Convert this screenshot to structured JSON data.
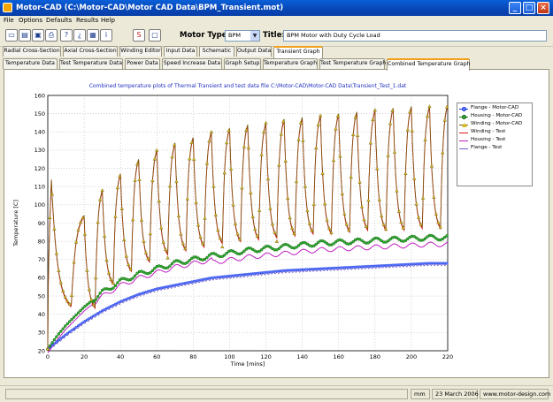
{
  "window": {
    "title": "Motor-CAD (C:\\Motor-CAD\\Motor CAD Data\\BPM_Transient.mot)",
    "minimize_glyph": "_",
    "maximize_glyph": "□",
    "close_glyph": "×"
  },
  "menu": [
    "File",
    "Options",
    "Defaults",
    "Results",
    "Help"
  ],
  "toolbar": {
    "icons": [
      "new-file-icon",
      "open-file-icon",
      "save-file-icon",
      "print-icon",
      "help-icon",
      "context-help-icon",
      "calculator-icon",
      "info-icon",
      "scaling-icon",
      "clipboard-icon"
    ],
    "motor_type_label": "Motor Type:",
    "motor_type_value": "BPM",
    "title_label": "Title:",
    "title_value": "BPM Motor with Duty Cycle Load"
  },
  "main_tabs": [
    "Radial Cross-Section",
    "Axial Cross-Section",
    "Winding Editor",
    "Input Data",
    "Schematic",
    "Output Data",
    "Transient Graph"
  ],
  "main_tab_active": "Transient Graph",
  "sub_tabs": [
    "Temperature Data",
    "Test Temperature Data",
    "Power Data",
    "Speed Increase Data",
    "Graph Setup",
    "Temperature Graph",
    "Test Temperature Graph",
    "Combined Temperature Graph"
  ],
  "sub_tab_active": "Combined Temperature Graph",
  "status": {
    "units": "mm",
    "date": "23 March 2006",
    "website": "www.motor-design.com"
  },
  "chart_data": {
    "type": "line",
    "title": "Combined temperature plots of Thermal Transient and test data file C:\\Motor-CAD\\Motor-CAD Data\\Transient_Test_1.dat",
    "xlabel": "Time [mins]",
    "ylabel": "Temperature [C]",
    "xlim": [
      0,
      220
    ],
    "ylim": [
      20,
      160
    ],
    "xticks": [
      0,
      20,
      40,
      60,
      80,
      100,
      120,
      140,
      160,
      180,
      200,
      220
    ],
    "yticks": [
      20,
      30,
      40,
      50,
      60,
      70,
      80,
      90,
      100,
      110,
      120,
      130,
      140,
      150,
      160
    ],
    "grid": true,
    "legend_position": "top-right",
    "colors": {
      "flange_cad": "#1a2fd8",
      "housing_cad": "#1a7a1a",
      "winding_cad": "#7a5a10",
      "winding_test": "#e01818",
      "housing_test": "#c020c0",
      "flange_test": "#7060d0"
    },
    "series": [
      {
        "name": "Flange - Motor-CAD",
        "key": "flange_cad",
        "marker": "circle-blue",
        "x": [
          0,
          5,
          10,
          20,
          30,
          40,
          50,
          60,
          70,
          80,
          90,
          100,
          110,
          120,
          130,
          140,
          150,
          160,
          170,
          180,
          190,
          200,
          210,
          220
        ],
        "y": [
          21,
          25,
          29,
          36,
          42,
          47,
          51,
          54,
          56,
          58,
          60,
          61,
          62,
          63,
          64,
          64.5,
          65,
          65.5,
          66,
          66.5,
          67,
          67.5,
          68,
          68
        ]
      },
      {
        "name": "Housing - Motor-CAD",
        "key": "housing_cad",
        "marker": "circle-green",
        "x": [
          0,
          5,
          10,
          20,
          30,
          40,
          50,
          60,
          70,
          80,
          90,
          100,
          110,
          120,
          130,
          140,
          150,
          160,
          170,
          180,
          190,
          200,
          210,
          220
        ],
        "y": [
          21,
          28,
          34,
          44,
          52,
          58,
          62,
          65,
          68,
          70,
          72,
          73.5,
          75,
          76,
          77,
          78,
          79,
          79.5,
          80,
          80.5,
          81,
          81.5,
          82,
          82
        ]
      },
      {
        "name": "Winding - Motor-CAD",
        "key": "winding_cad",
        "marker": "triangle-yellow",
        "peak_times": [
          2,
          20,
          30,
          40,
          50,
          60,
          70,
          80,
          90,
          100,
          110,
          120,
          130,
          140,
          150,
          160,
          170,
          180,
          190,
          200,
          210,
          220
        ],
        "peak_values": [
          114,
          94,
          108,
          117,
          125,
          130,
          134,
          137,
          140,
          142,
          144,
          145,
          147,
          148,
          149,
          150,
          151,
          152,
          153,
          154,
          154,
          155
        ],
        "trough_values": [
          42,
          42,
          55,
          62,
          67,
          71,
          73,
          75,
          77,
          78,
          79,
          80,
          81,
          82,
          82,
          83,
          84,
          84,
          84,
          85,
          85,
          85
        ]
      },
      {
        "name": "Winding - Test",
        "key": "winding_test",
        "marker": "line"
      },
      {
        "name": "Housing - Test",
        "key": "housing_test",
        "marker": "line"
      },
      {
        "name": "Flange - Test",
        "key": "flange_test",
        "marker": "line"
      }
    ]
  }
}
